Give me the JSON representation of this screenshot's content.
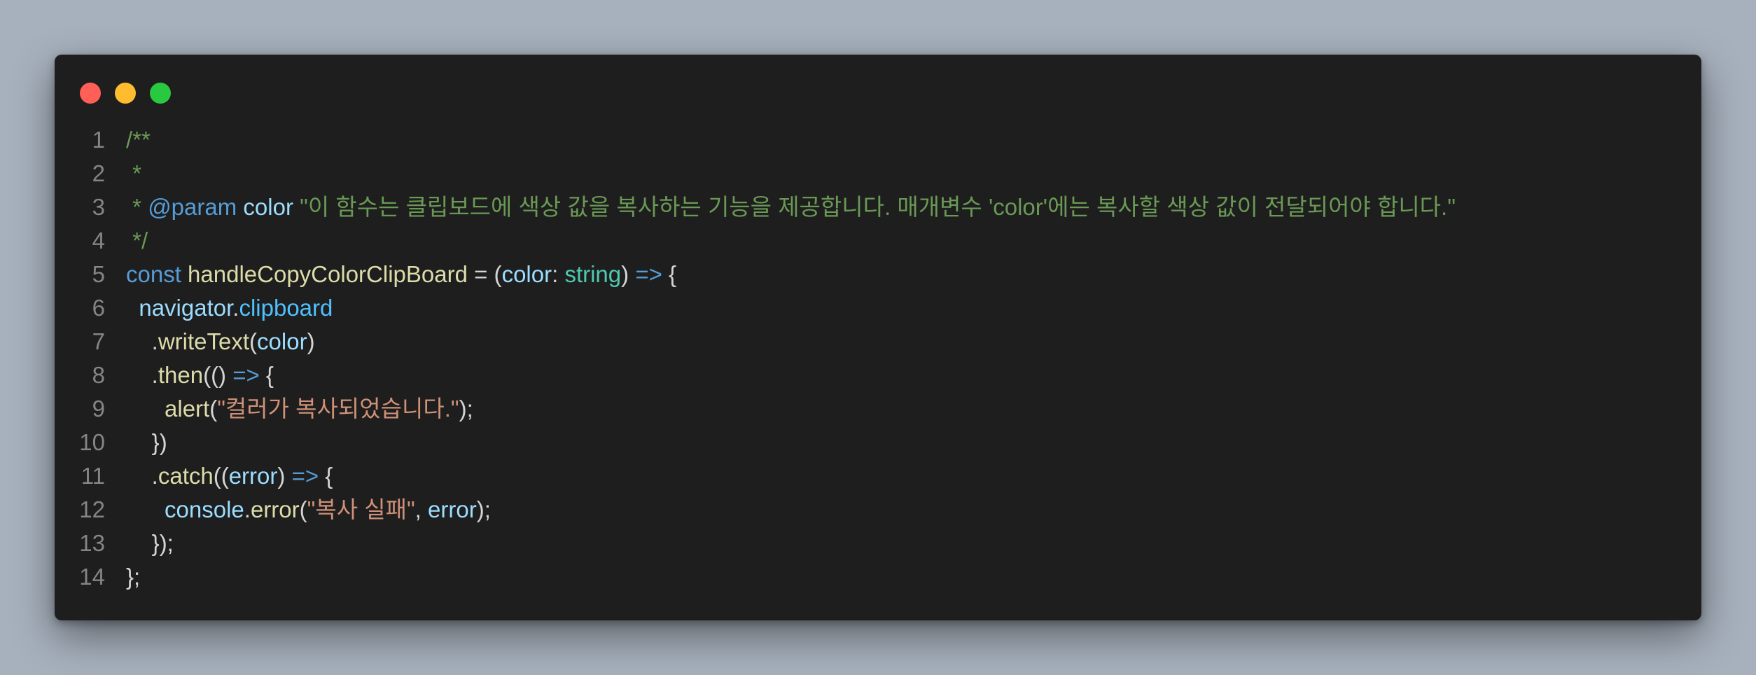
{
  "window": {
    "controls": [
      "close",
      "minimize",
      "maximize"
    ],
    "colors": {
      "close": "#ff5f57",
      "minimize": "#febc2e",
      "maximize": "#28c840",
      "background": "#1e1e1e"
    }
  },
  "code": {
    "lines": [
      {
        "num": "1",
        "tokens": [
          "/**"
        ]
      },
      {
        "num": "2",
        "tokens": [
          " *"
        ]
      },
      {
        "num": "3",
        "tokens": [
          " * ",
          "@param",
          " ",
          "color",
          " \"이 함수는 클립보드에 색상 값을 복사하는 기능을 제공합니다. 매개변수 'color'에는 복사할 색상 값이 전달되어야 합니다.\""
        ]
      },
      {
        "num": "4",
        "tokens": [
          " */"
        ]
      },
      {
        "num": "5",
        "tokens": [
          "const",
          " ",
          "handleCopyColorClipBoard",
          " = (",
          "color",
          ": ",
          "string",
          ") ",
          "=>",
          " {"
        ]
      },
      {
        "num": "6",
        "tokens": [
          "  ",
          "navigator",
          ".",
          "clipboard"
        ]
      },
      {
        "num": "7",
        "tokens": [
          "    .",
          "writeText",
          "(",
          "color",
          ")"
        ]
      },
      {
        "num": "8",
        "tokens": [
          "    .",
          "then",
          "(() ",
          "=>",
          " {"
        ]
      },
      {
        "num": "9",
        "tokens": [
          "      ",
          "alert",
          "(",
          "\"컬러가 복사되었습니다.\"",
          ");"
        ]
      },
      {
        "num": "10",
        "tokens": [
          "    })"
        ]
      },
      {
        "num": "11",
        "tokens": [
          "    .",
          "catch",
          "((",
          "error",
          ") ",
          "=>",
          " {"
        ]
      },
      {
        "num": "12",
        "tokens": [
          "      ",
          "console",
          ".",
          "error",
          "(",
          "\"복사 실패\"",
          ", ",
          "error",
          ");"
        ]
      },
      {
        "num": "13",
        "tokens": [
          "    });"
        ]
      },
      {
        "num": "14",
        "tokens": [
          "};"
        ]
      }
    ]
  }
}
